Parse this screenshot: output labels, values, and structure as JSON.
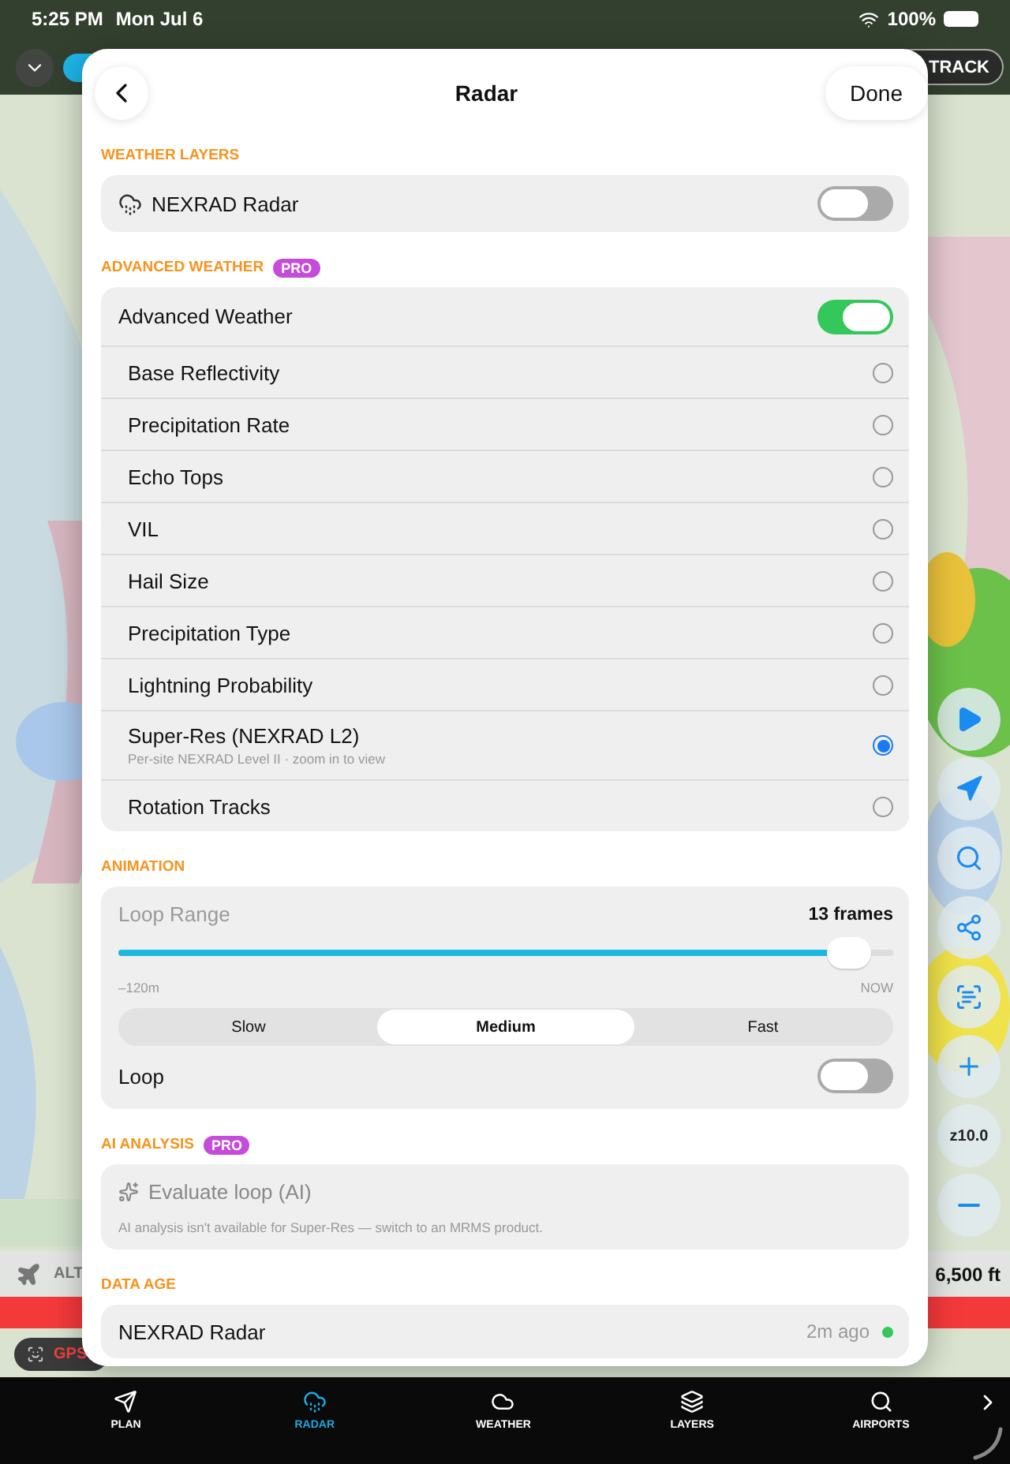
{
  "status_bar": {
    "time": "5:25 PM",
    "date": "Mon Jul 6",
    "battery": "100%"
  },
  "map_controls": {
    "track_button": "TRACK",
    "zoom_level": "z10.0",
    "altitude_label": "ALT",
    "altitude_value": "6,500 ft",
    "gps_label": "GPS"
  },
  "sheet": {
    "title": "Radar",
    "done": "Done",
    "weather_layers": {
      "heading": "WEATHER LAYERS",
      "rows": [
        {
          "label": "NEXRAD Radar",
          "on": false
        }
      ]
    },
    "advanced_weather": {
      "heading": "ADVANCED WEATHER",
      "badge": "PRO",
      "toggle": {
        "label": "Advanced Weather",
        "on": true
      },
      "products": [
        {
          "label": "Base Reflectivity",
          "selected": false
        },
        {
          "label": "Precipitation Rate",
          "selected": false
        },
        {
          "label": "Echo Tops",
          "selected": false
        },
        {
          "label": "VIL",
          "selected": false
        },
        {
          "label": "Hail Size",
          "selected": false
        },
        {
          "label": "Precipitation Type",
          "selected": false
        },
        {
          "label": "Lightning Probability",
          "selected": false
        },
        {
          "label": "Super-Res (NEXRAD L2)",
          "subtitle": "Per-site NEXRAD Level II · zoom in to view",
          "selected": true
        },
        {
          "label": "Rotation Tracks",
          "selected": false
        }
      ]
    },
    "animation": {
      "heading": "ANIMATION",
      "loop_range": {
        "label": "Loop Range",
        "reading": "13 frames",
        "level": 0.97,
        "min_label": "–120m",
        "max_label": "NOW"
      },
      "speeds": [
        {
          "label": "Slow",
          "selected": false
        },
        {
          "label": "Medium",
          "selected": true
        },
        {
          "label": "Fast",
          "selected": false
        }
      ],
      "loop": {
        "label": "Loop",
        "on": false
      }
    },
    "ai_analysis": {
      "heading": "AI ANALYSIS",
      "badge": "PRO",
      "button": "Evaluate loop (AI)",
      "note": "AI analysis isn't available for Super-Res — switch to an MRMS product."
    },
    "data_age": {
      "heading": "DATA AGE",
      "rows": [
        {
          "label": "NEXRAD Radar",
          "age": "2m ago",
          "color": "#34c759"
        }
      ]
    }
  },
  "tab_bar": [
    {
      "label": "PLAN",
      "selected": false
    },
    {
      "label": "RADAR",
      "selected": true
    },
    {
      "label": "WEATHER",
      "selected": false
    },
    {
      "label": "LAYERS",
      "selected": false
    },
    {
      "label": "AIRPORTS",
      "selected": false
    }
  ]
}
